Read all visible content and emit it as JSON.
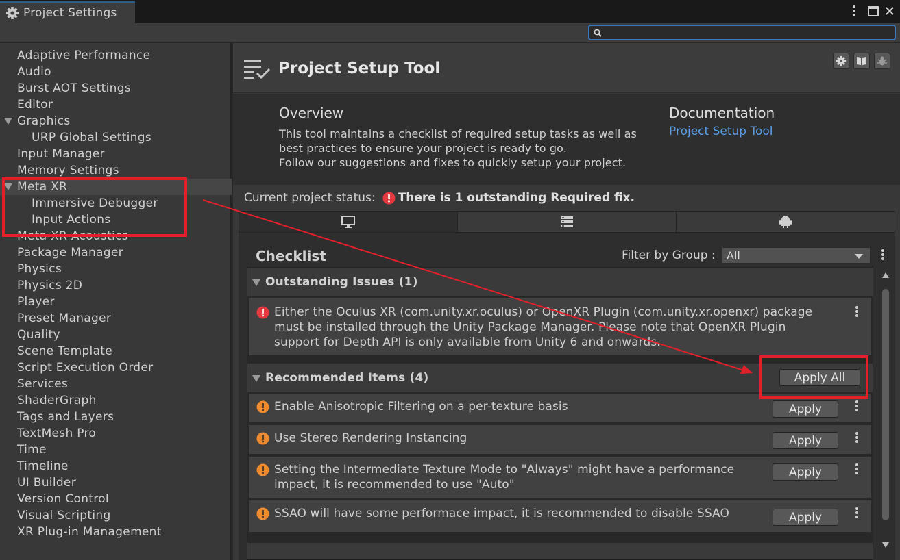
{
  "window": {
    "tab_title": "Project Settings",
    "search": {
      "value": "",
      "placeholder": ""
    }
  },
  "sidebar": {
    "items": [
      {
        "label": "Adaptive Performance",
        "level": 0
      },
      {
        "label": "Audio",
        "level": 0
      },
      {
        "label": "Burst AOT Settings",
        "level": 0
      },
      {
        "label": "Editor",
        "level": 0
      },
      {
        "label": "Graphics",
        "level": 0,
        "expanded": true
      },
      {
        "label": "URP Global Settings",
        "level": 1
      },
      {
        "label": "Input Manager",
        "level": 0
      },
      {
        "label": "Memory Settings",
        "level": 0
      },
      {
        "label": "Meta XR",
        "level": 0,
        "expanded": true,
        "selected": true
      },
      {
        "label": "Immersive Debugger",
        "level": 1
      },
      {
        "label": "Input Actions",
        "level": 1
      },
      {
        "label": "Meta XR Acoustics",
        "level": 0
      },
      {
        "label": "Package Manager",
        "level": 0
      },
      {
        "label": "Physics",
        "level": 0
      },
      {
        "label": "Physics 2D",
        "level": 0
      },
      {
        "label": "Player",
        "level": 0
      },
      {
        "label": "Preset Manager",
        "level": 0
      },
      {
        "label": "Quality",
        "level": 0
      },
      {
        "label": "Scene Template",
        "level": 0
      },
      {
        "label": "Script Execution Order",
        "level": 0
      },
      {
        "label": "Services",
        "level": 0
      },
      {
        "label": "ShaderGraph",
        "level": 0
      },
      {
        "label": "Tags and Layers",
        "level": 0
      },
      {
        "label": "TextMesh Pro",
        "level": 0
      },
      {
        "label": "Time",
        "level": 0
      },
      {
        "label": "Timeline",
        "level": 0
      },
      {
        "label": "UI Builder",
        "level": 0
      },
      {
        "label": "Version Control",
        "level": 0
      },
      {
        "label": "Visual Scripting",
        "level": 0
      },
      {
        "label": "XR Plug-in Management",
        "level": 0
      }
    ]
  },
  "main": {
    "title": "Project Setup Tool",
    "overview": {
      "title": "Overview",
      "lines": [
        "This tool maintains a checklist of required setup tasks as well as",
        "best practices to ensure your project is ready to go.",
        "Follow our suggestions and fixes to quickly setup your project."
      ]
    },
    "documentation": {
      "title": "Documentation",
      "link": "Project Setup Tool"
    },
    "status": {
      "label": "Current project status:",
      "message": "There is 1 outstanding Required fix."
    },
    "platform_tabs": [
      {
        "icon": "desktop-icon",
        "active": true
      },
      {
        "icon": "server-icon",
        "active": false
      },
      {
        "icon": "android-icon",
        "active": false
      }
    ],
    "checklist": {
      "title": "Checklist",
      "filter_label": "Filter by Group :",
      "filter_value": "All",
      "groups": [
        {
          "title": "Outstanding Issues (1)",
          "severity": "error",
          "items": [
            {
              "lines": [
                "Either the Oculus XR (com.unity.xr.oculus) or OpenXR Plugin (com.unity.xr.openxr) package",
                "must be installed through the Unity Package Manager. Please note that OpenXR Plugin",
                "support for Depth API is only available from Unity 6 and onwards."
              ]
            }
          ]
        },
        {
          "title": "Recommended Items (4)",
          "severity": "warning",
          "apply_all_label": "Apply All",
          "items": [
            {
              "lines": [
                "Enable Anisotropic Filtering on a per-texture basis"
              ],
              "button": "Apply"
            },
            {
              "lines": [
                "Use Stereo Rendering Instancing"
              ],
              "button": "Apply"
            },
            {
              "lines": [
                "Setting the Intermediate Texture Mode to \"Always\" might have a performance",
                "impact, it is recommended to use \"Auto\""
              ],
              "button": "Apply"
            },
            {
              "lines": [
                "SSAO will have some performace impact, it is recommended to disable SSAO"
              ],
              "button": "Apply"
            }
          ]
        }
      ]
    }
  },
  "colors": {
    "error": "#e5393f",
    "warning": "#ef8b2c",
    "link": "#5c9ee6",
    "annotation": "#e3202a",
    "focus": "#3a79bb"
  }
}
